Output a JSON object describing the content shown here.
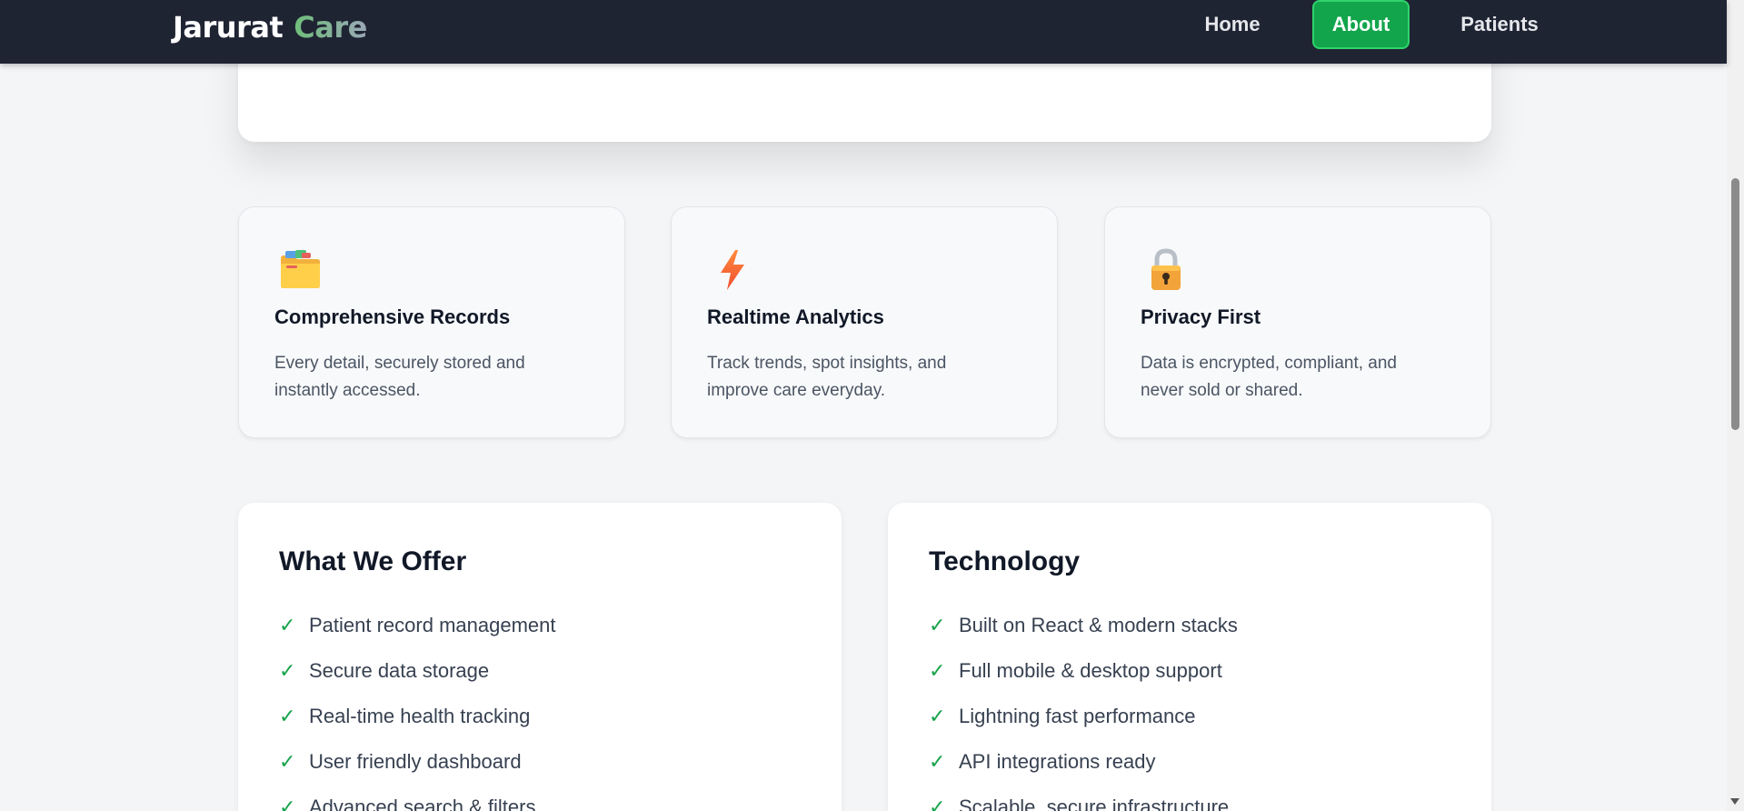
{
  "nav": {
    "brand_part1": "Jarurat",
    "brand_part2": "Care",
    "links": [
      {
        "label": "Home",
        "active": false
      },
      {
        "label": "About",
        "active": true
      },
      {
        "label": "Patients",
        "active": false
      }
    ],
    "active_color": "#12a54b"
  },
  "features": [
    {
      "icon": "folder-icon",
      "title": "Comprehensive Records",
      "description": "Every detail, securely stored and instantly accessed."
    },
    {
      "icon": "lightning-icon",
      "title": "Realtime Analytics",
      "description": "Track trends, spot insights, and improve care everyday."
    },
    {
      "icon": "lock-icon",
      "title": "Privacy First",
      "description": "Data is encrypted, compliant, and never sold or shared."
    }
  ],
  "offer": {
    "title": "What We Offer",
    "items": [
      "Patient record management",
      "Secure data storage",
      "Real-time health tracking",
      "User friendly dashboard",
      "Advanced search & filters"
    ]
  },
  "technology": {
    "title": "Technology",
    "items": [
      "Built on React & modern stacks",
      "Full mobile & desktop support",
      "Lightning fast performance",
      "API integrations ready",
      "Scalable, secure infrastructure"
    ]
  },
  "check_glyph": "✓",
  "colors": {
    "navbar": "#1f2433",
    "accent_green": "#16a34a",
    "page_bg": "#f4f5f7"
  }
}
